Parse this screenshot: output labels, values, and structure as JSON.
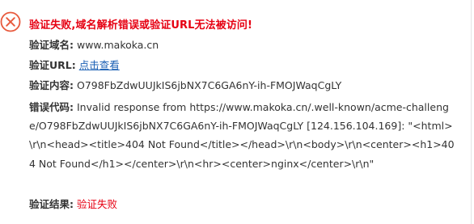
{
  "headline": "验证失败,域名解析错误或验证URL无法被访问!",
  "fields": {
    "domain_label": "验证域名:",
    "domain_value": "www.makoka.cn",
    "url_label": "验证URL:",
    "url_link": "点击查看",
    "content_label": "验证内容:",
    "content_value": "O798FbZdwUUJkIS6jbNX7C6GA6nY-ih-FMOJWaqCgLY",
    "error_label": "错误代码:",
    "error_value": "Invalid response from https://www.makoka.cn/.well-known/acme-challenge/O798FbZdwUUJkIS6jbNX7C6GA6nY-ih-FMOJWaqCgLY [124.156.104.169]: \"<html>\\r\\n<head><title>404 Not Found</title></head>\\r\\n<body>\\r\\n<center><h1>404 Not Found</h1></center>\\r\\n<hr><center>nginx</center>\\r\\n\"",
    "result_label": "验证结果:",
    "result_value": "验证失败"
  },
  "colors": {
    "error_red": "#e60012",
    "link_blue": "#1a5fb4",
    "text": "#333333"
  },
  "icons": {
    "status": "error-circle-x-icon"
  }
}
